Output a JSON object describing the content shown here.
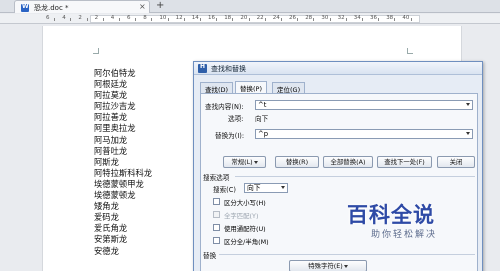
{
  "tabbar": {
    "doc_tab_title": "恐龙.doc *",
    "close_glyph": "×",
    "new_tab_glyph": "+"
  },
  "ruler": {
    "numbers": [
      "6",
      "4",
      "2",
      "2",
      "4",
      "6",
      "8",
      "10",
      "12",
      "14",
      "16",
      "18",
      "20",
      "22",
      "24",
      "26",
      "28",
      "30",
      "32",
      "34",
      "36",
      "38",
      "40"
    ]
  },
  "document": {
    "lines": [
      "阿尔伯特龙",
      "阿根廷龙",
      "阿拉莫龙",
      "阿拉沙吉龙",
      "阿拉善龙",
      "阿里奥拉龙",
      "阿马加龙",
      "阿普吐龙",
      "阿斯龙",
      "阿特拉斯科科龙",
      "埃德蒙顿甲龙",
      "埃德蒙顿龙",
      "矮角龙",
      "爱码龙",
      "爱氏角龙",
      "安第斯龙",
      "安德龙"
    ]
  },
  "dialog": {
    "title": "查找和替换",
    "tabs": [
      "查找(D)",
      "替换(P)",
      "定位(G)"
    ],
    "active_tab": 1,
    "find_label": "查找内容(N):",
    "find_value": "^t",
    "options_label": "选项:",
    "options_value": "向下",
    "replace_label": "替换为(I):",
    "replace_value": "^p",
    "buttons": {
      "general": "常规(L)",
      "replace": "替换(R)",
      "replace_all": "全部替换(A)",
      "find_next": "查找下一处(F)",
      "close": "关闭"
    },
    "search_section_label": "搜索选项",
    "search_label": "搜索(C)",
    "search_value": "向下",
    "checkboxes": [
      {
        "label": "区分大小写(H)",
        "enabled": true
      },
      {
        "label": "全字匹配(Y)",
        "enabled": false
      },
      {
        "label": "使用通配符(U)",
        "enabled": true
      },
      {
        "label": "区分全/半角(M)",
        "enabled": true
      }
    ],
    "replace_section_label": "替换",
    "special_chars_button": "特殊字符(E)"
  },
  "watermark": {
    "title": "百科全说",
    "subtitle": "助你轻松解决"
  }
}
